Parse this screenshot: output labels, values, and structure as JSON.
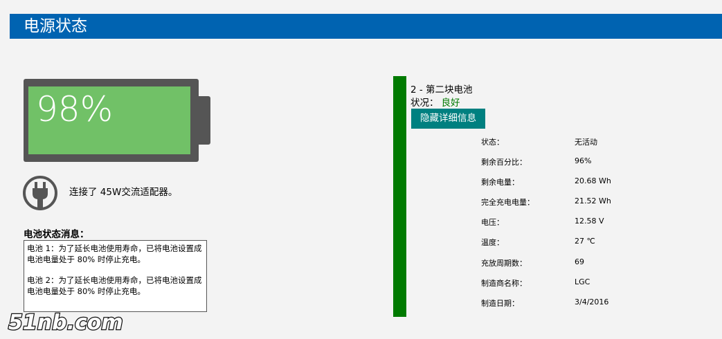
{
  "header": {
    "title": "电源状态"
  },
  "battery_overall": {
    "percent_text": "98%",
    "level": 0.98
  },
  "adapter": {
    "text": "连接了 45W交流适配器。"
  },
  "messages": {
    "title": "电池状态消息：",
    "items": [
      "电池 1：为了延长电池使用寿命，已将电池设置成电池电量处于 80% 时停止充电。",
      "电池 2：为了延长电池使用寿命，已将电池设置成电池电量处于 80% 时停止充电。"
    ]
  },
  "battery2": {
    "name": "2 - 第二块电池",
    "status_label": "状况：",
    "status_value": "良好",
    "hide_button": "隐藏详细信息",
    "details": [
      {
        "label": "状态：",
        "value": "无活动"
      },
      {
        "label": "剩余百分比：",
        "value": "96%"
      },
      {
        "label": "剩余电量：",
        "value": "20.68 Wh"
      },
      {
        "label": "完全充电电量：",
        "value": "21.52 Wh"
      },
      {
        "label": "电压：",
        "value": "12.58 V"
      },
      {
        "label": "温度：",
        "value": "27 ℃"
      },
      {
        "label": "充放周期数：",
        "value": "69"
      },
      {
        "label": "制造商名称：",
        "value": "LGC"
      },
      {
        "label": "制造日期：",
        "value": "3/4/2016"
      }
    ]
  },
  "watermark": {
    "text": "51nb.com"
  },
  "colors": {
    "header": "#0063b1",
    "battery_fill": "#71c167",
    "good": "#007a00",
    "button": "#008080"
  },
  "icons": {
    "adapter": "power-plug-icon"
  }
}
